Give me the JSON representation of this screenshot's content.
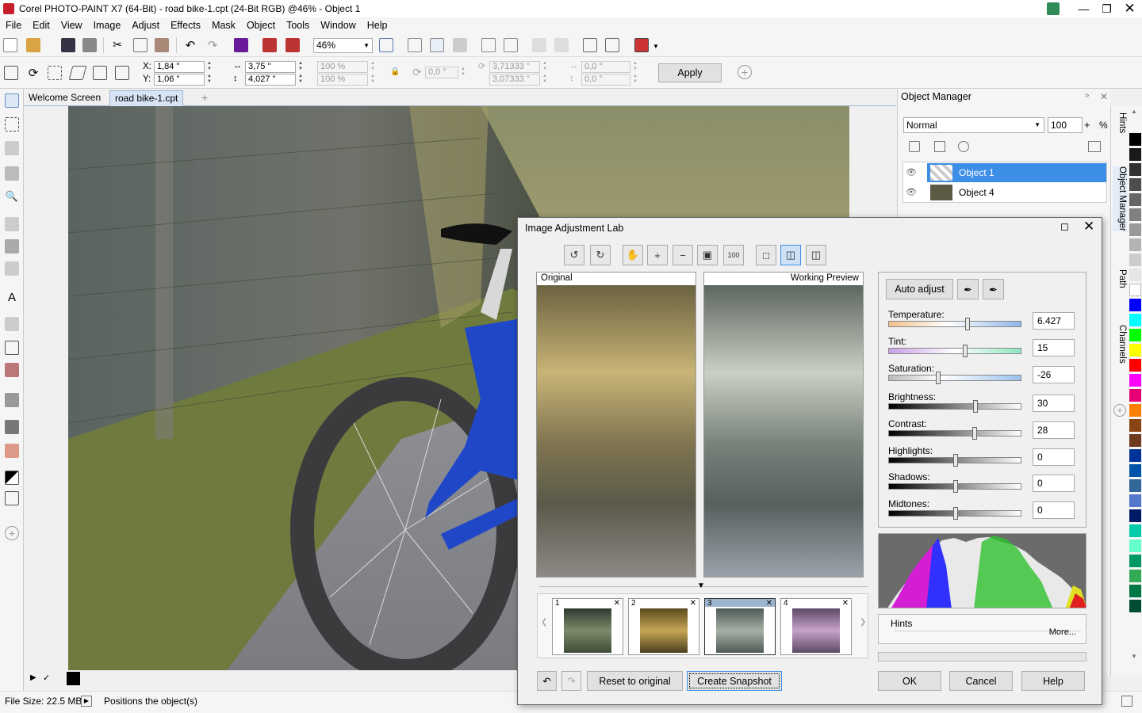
{
  "window": {
    "title": "Corel PHOTO-PAINT X7 (64-Bit) - road bike-1.cpt (24-Bit RGB) @46% - Object 1",
    "minimize_icon": "minimize-icon",
    "restore_icon": "restore-icon",
    "close_icon": "close-icon"
  },
  "menu": [
    "File",
    "Edit",
    "View",
    "Image",
    "Adjust",
    "Effects",
    "Mask",
    "Object",
    "Tools",
    "Window",
    "Help"
  ],
  "toolbar": {
    "zoom": "46%"
  },
  "propbar": {
    "x_label": "X:",
    "x": "1,84 \"",
    "y_label": "Y:",
    "y": "1,06 \"",
    "w": "3,75 \"",
    "h": "4,027 \"",
    "sw": "100 %",
    "sh": "100 %",
    "rot": "0,0 °",
    "cx": "3,71333 \"",
    "cy": "3,07333 \"",
    "skx": "0,0 °",
    "sky": "0,0 °",
    "apply": "Apply"
  },
  "tabs": {
    "welcome": "Welcome Screen",
    "doc": "road bike-1.cpt"
  },
  "object_manager": {
    "title": "Object Manager",
    "blend_mode": "Normal",
    "opacity": "100",
    "percent": "%",
    "objects": [
      {
        "name": "Object 1",
        "selected": true
      },
      {
        "name": "Object 4",
        "selected": false
      }
    ]
  },
  "dock_tabs": {
    "hints": "Hints",
    "object_manager": "Object Manager",
    "path": "Path",
    "channels": "Channels"
  },
  "status": {
    "file_size": "File Size: 22.5 MB",
    "message": "Positions the object(s)"
  },
  "dialog": {
    "title": "Image Adjustment Lab",
    "original_label": "Original",
    "preview_label": "Working Preview",
    "auto_adjust": "Auto adjust",
    "sliders": [
      {
        "label": "Temperature:",
        "value": "6.427",
        "pos": 0.59
      },
      {
        "label": "Tint:",
        "value": "15",
        "pos": 0.57
      },
      {
        "label": "Saturation:",
        "value": "-26",
        "pos": 0.37
      },
      {
        "label": "Brightness:",
        "value": "30",
        "pos": 0.65
      },
      {
        "label": "Contrast:",
        "value": "28",
        "pos": 0.64
      },
      {
        "label": "Highlights:",
        "value": "0",
        "pos": 0.5
      },
      {
        "label": "Shadows:",
        "value": "0",
        "pos": 0.5
      },
      {
        "label": "Midtones:",
        "value": "0",
        "pos": 0.5
      }
    ],
    "hints_label": "Hints",
    "more": "More...",
    "snapshots": [
      "1",
      "2",
      "3",
      "4"
    ],
    "reset": "Reset to original",
    "create_snapshot": "Create Snapshot",
    "ok": "OK",
    "cancel": "Cancel",
    "help": "Help"
  },
  "palette_colors": [
    "#000000",
    "#1a1a1a",
    "#333333",
    "#4d4d4d",
    "#666666",
    "#808080",
    "#999999",
    "#b3b3b3",
    "#cccccc",
    "#e6e6e6",
    "#ffffff",
    "#0000ff",
    "#00ffff",
    "#00ff00",
    "#ffff00",
    "#ff0000",
    "#ff00ff",
    "#e60073",
    "#ff8000",
    "#8b4513",
    "#6e3b1f",
    "#003399",
    "#0055aa",
    "#336699",
    "#5577cc",
    "#001a66",
    "#00ccaa",
    "#66ffcc",
    "#009966",
    "#33aa55",
    "#007744",
    "#004d33"
  ]
}
